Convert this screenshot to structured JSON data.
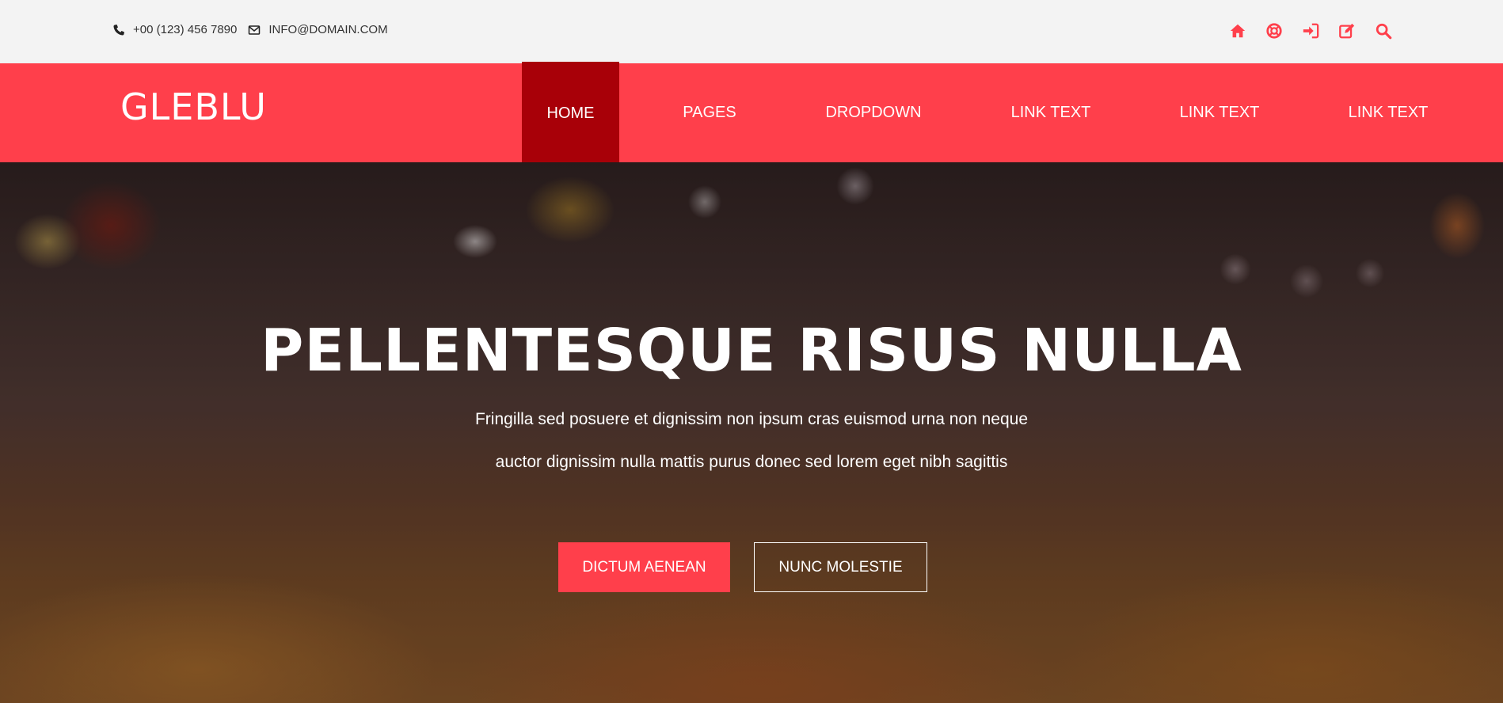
{
  "topbar": {
    "phone": "+00 (123) 456 7890",
    "email": "INFO@DOMAIN.COM",
    "icons": [
      "home-icon",
      "lifebuoy-icon",
      "sign-in-icon",
      "edit-icon",
      "search-icon"
    ]
  },
  "brand": {
    "logo": "GLEBLU"
  },
  "nav": {
    "items": [
      {
        "label": "HOME"
      },
      {
        "label": "PAGES"
      },
      {
        "label": "DROPDOWN"
      },
      {
        "label": "LINK TEXT"
      },
      {
        "label": "LINK TEXT"
      },
      {
        "label": "LINK TEXT"
      }
    ]
  },
  "hero": {
    "title": "PELLENTESQUE RISUS NULLA",
    "line1": "Fringilla sed posuere et dignissim non ipsum cras euismod urna non neque",
    "line2": "auctor dignissim nulla mattis purus donec sed lorem eget nibh sagittis",
    "primary_button": "DICTUM AENEAN",
    "secondary_button": "NUNC MOLESTIE"
  },
  "colors": {
    "accent": "#ff3f4b",
    "active_nav": "#a80008",
    "topbar_bg": "#f3f3f3"
  }
}
